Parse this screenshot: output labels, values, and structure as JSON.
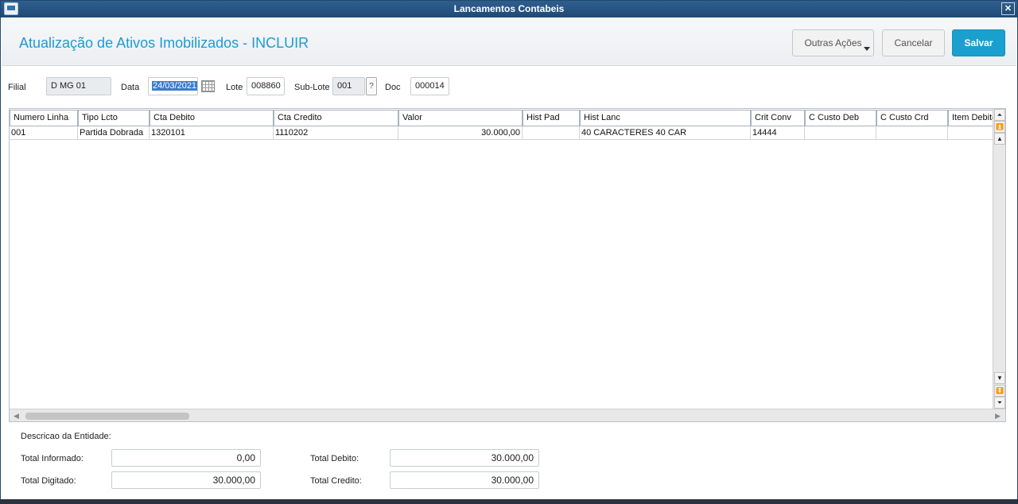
{
  "window": {
    "title": "Lancamentos Contabeis",
    "close_glyph": "✕"
  },
  "header": {
    "page_title": "Atualização de Ativos Imobilizados - INCLUIR",
    "outras_acoes_label": "Outras Ações",
    "cancelar_label": "Cancelar",
    "salvar_label": "Salvar"
  },
  "form": {
    "filial_label": "Filial",
    "filial_value": "D MG 01",
    "data_label": "Data",
    "data_value": "24/03/2021",
    "lote_label": "Lote",
    "lote_value": "008860",
    "sublote_label": "Sub-Lote",
    "sublote_value": "001",
    "help_glyph": "?",
    "doc_label": "Doc",
    "doc_value": "000014"
  },
  "grid": {
    "columns": [
      "Numero Linha",
      "Tipo Lcto",
      "Cta Debito",
      "Cta Credito",
      "Valor",
      "Hist Pad",
      "Hist Lanc",
      "Crit Conv",
      "C Custo Deb",
      "C Custo Crd",
      "Item Debito"
    ],
    "rows": [
      [
        "001",
        "Partida Dobrada",
        "1320101",
        "1110202",
        "30.000,00",
        "",
        "40 CARACTERES 40 CAR",
        "14444",
        "",
        "",
        ""
      ]
    ],
    "scroll_glyphs": {
      "top": "⏶",
      "page_up": "⏫",
      "up": "▲",
      "down": "▼",
      "page_down": "⏬",
      "bottom": "⏷",
      "left": "◀",
      "right": "▶"
    }
  },
  "footer": {
    "descricao_label": "Descricao da Entidade:",
    "total_informado_label": "Total Informado:",
    "total_informado_value": "0,00",
    "total_digitado_label": "Total Digitado:",
    "total_digitado_value": "30.000,00",
    "total_debito_label": "Total Debito:",
    "total_debito_value": "30.000,00",
    "total_credito_label": "Total Credito:",
    "total_credito_value": "30.000,00"
  }
}
